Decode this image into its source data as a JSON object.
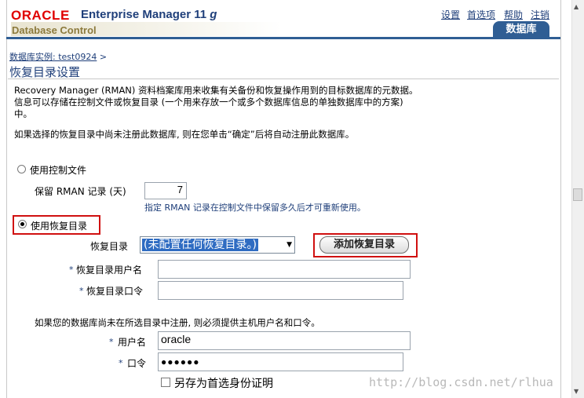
{
  "header": {
    "brand": "ORACLE",
    "product": "Enterprise Manager 11",
    "version_suffix": "g",
    "subtitle": "Database Control",
    "links": [
      "设置",
      "首选项",
      "帮助",
      "注销"
    ],
    "tab": "数据库"
  },
  "breadcrumb": {
    "link": "数据库实例: test0924",
    "separator": ">"
  },
  "page": {
    "title": "恢复目录设置",
    "description": "Recovery Manager (RMAN) 资料档案库用来收集有关备份和恢复操作用到的目标数据库的元数据。信息可以存储在控制文件或恢复目录 (一个用来存放一个或多个数据库信息的单独数据库中的方案) 中。",
    "note": "如果选择的恢复目录中尚未注册此数据库, 则在您单击“确定”后将自动注册此数据库。"
  },
  "control_file": {
    "radio_label": "使用控制文件",
    "selected": false,
    "retain_label": "保留  RMAN 记录 (天)",
    "retain_value": "7",
    "hint": "指定  RMAN 记录在控制文件中保留多久后才可重新使用。"
  },
  "recovery_catalog": {
    "radio_label": "使用恢复目录",
    "selected": true,
    "catalog_label": "恢复目录",
    "catalog_value": "(未配置任何恢复目录。)",
    "add_button": "添加恢复目录",
    "required_marker": "*",
    "username_label": "恢复目录用户名",
    "username_value": "",
    "password_label": "恢复目录口令",
    "password_value": ""
  },
  "host_credentials": {
    "note": "如果您的数据库尚未在所选目录中注册, 则必须提供主机用户名和口令。",
    "username_label": "用户名",
    "username_value": "oracle",
    "password_label": "口令",
    "password_value": "●●●●●●",
    "save_label": "另存为首选身份证明",
    "save_checked": false
  },
  "watermark": "http://blog.csdn.net/rlhua",
  "colors": {
    "accent": "#1f3f7a",
    "brand_red": "#e00000",
    "highlight_red": "#d01010",
    "tab_blue": "#2f5e94"
  }
}
